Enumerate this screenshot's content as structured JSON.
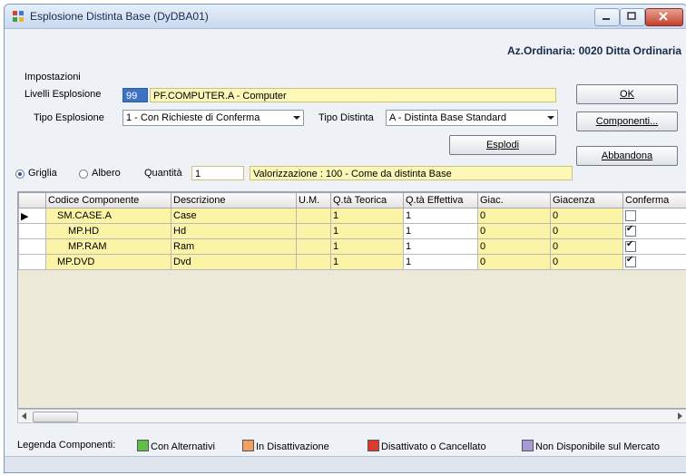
{
  "window": {
    "title": "Esplosione Distinta Base (DyDBA01)",
    "company": "Az.Ordinaria: 0020 Ditta Ordinaria"
  },
  "settings": {
    "section_label": "Impostazioni",
    "levels_label": "Livelli Esplosione",
    "levels_value": "99",
    "article_value": "PF.COMPUTER.A - Computer",
    "explosion_type_label": "Tipo Esplosione",
    "explosion_type_value": "1 - Con Richieste di Conferma",
    "bom_type_label": "Tipo Distinta",
    "bom_type_value": "A - Distinta Base Standard"
  },
  "buttons": {
    "ok": "OK",
    "components": "Componenti...",
    "explode": "Esplodi",
    "cancel": "Abbandona"
  },
  "view": {
    "grid_label": "Griglia",
    "tree_label": "Albero",
    "quantity_label": "Quantità",
    "quantity_value": "1",
    "valuation_text": "Valorizzazione : 100 - Come da distinta Base"
  },
  "table": {
    "columns": [
      "",
      "Codice Componente",
      "Descrizione",
      "U.M.",
      "Q.tà Teorica",
      "Q.tà Effettiva",
      "Giac.",
      "Giacenza",
      "Conferma"
    ],
    "rows": [
      {
        "marker": "▶",
        "code": "SM.CASE.A",
        "desc": "Case",
        "um": "",
        "qt": "1",
        "qe": "1",
        "giac": "0",
        "giacenza": "0",
        "confirm": false,
        "indent": 1
      },
      {
        "marker": "",
        "code": "MP.HD",
        "desc": "Hd",
        "um": "",
        "qt": "1",
        "qe": "1",
        "giac": "0",
        "giacenza": "0",
        "confirm": true,
        "indent": 2
      },
      {
        "marker": "",
        "code": "MP.RAM",
        "desc": "Ram",
        "um": "",
        "qt": "1",
        "qe": "1",
        "giac": "0",
        "giacenza": "0",
        "confirm": true,
        "indent": 2
      },
      {
        "marker": "",
        "code": "MP.DVD",
        "desc": "Dvd",
        "um": "",
        "qt": "1",
        "qe": "1",
        "giac": "0",
        "giacenza": "0",
        "confirm": true,
        "indent": 1
      }
    ]
  },
  "legend": {
    "title": "Legenda Componenti:",
    "items": [
      {
        "label": "Con Alternativi",
        "color": "#5fbf4a"
      },
      {
        "label": "In Disattivazione",
        "color": "#f0a060"
      },
      {
        "label": "Disattivato o Cancellato",
        "color": "#e03a2a"
      },
      {
        "label": "Non Disponibile sul Mercato",
        "color": "#a69bd6"
      }
    ]
  }
}
